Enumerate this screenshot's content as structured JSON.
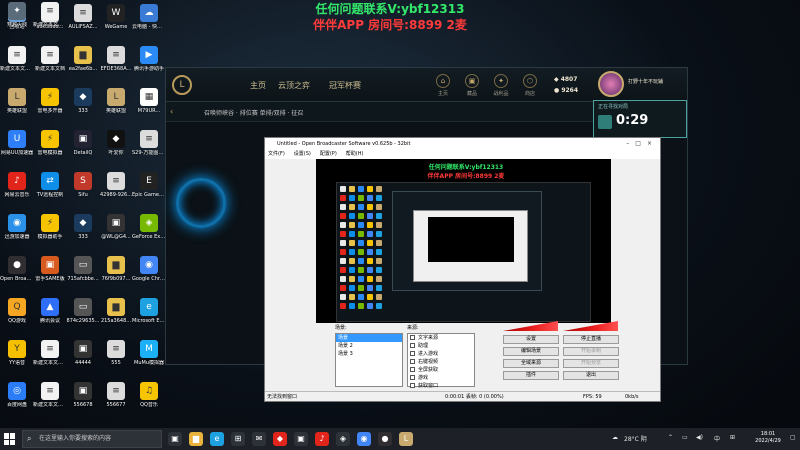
{
  "overlay": {
    "line1": "任何问题联系V:ybf12313",
    "line2": "伴伴APP 房间号:8899 2麦"
  },
  "desktop_icons": [
    {
      "label": "回收站",
      "icon": "recycle-bin-icon",
      "color": "#6aa0d8",
      "glyph": "♻"
    },
    {
      "label": "a363ddd...",
      "icon": "file-icon",
      "color": "#e9e9e9",
      "glyph": "▤"
    },
    {
      "label": "AULIFSAZ...",
      "icon": "document-icon",
      "color": "#dcdcdc",
      "glyph": "≡"
    },
    {
      "label": "WeGame",
      "icon": "wegame-icon",
      "color": "#222",
      "glyph": "W"
    },
    {
      "label": "云电脑 - 快捷方式",
      "icon": "cloud-pc-icon",
      "color": "#3a7bd5",
      "glyph": "☁"
    },
    {
      "label": "新建文本文档(5)",
      "icon": "text-file-icon",
      "color": "#f2f2f2",
      "glyph": "≡"
    },
    {
      "label": "新建文本文档",
      "icon": "text-file-icon",
      "color": "#f2f2f2",
      "glyph": "≡"
    },
    {
      "label": "ea2fae6b...",
      "icon": "folder-icon",
      "color": "#e8c04c",
      "glyph": "▆"
    },
    {
      "label": "EFDE368A...",
      "icon": "document-icon",
      "color": "#dcdcdc",
      "glyph": "≡"
    },
    {
      "label": "腾讯手游助手",
      "icon": "game-assistant-icon",
      "color": "#2a8af6",
      "glyph": "▶"
    },
    {
      "label": "英雄联盟",
      "icon": "lol-icon",
      "color": "#c8aa6e",
      "glyph": "L"
    },
    {
      "label": "雷电多开器",
      "icon": "emulator-icon",
      "color": "#f6c400",
      "glyph": "⚡"
    },
    {
      "label": "333",
      "icon": "app-icon",
      "color": "#1a3a5e",
      "glyph": "◆"
    },
    {
      "label": "英雄联盟",
      "icon": "lol-icon",
      "color": "#c8aa6e",
      "glyph": "L"
    },
    {
      "label": "M79UR...",
      "icon": "qr-icon",
      "color": "#fff",
      "glyph": "▦"
    },
    {
      "label": "网易UU加速器",
      "icon": "uu-accelerator-icon",
      "color": "#2d7ef7",
      "glyph": "U"
    },
    {
      "label": "雷电模拟器",
      "icon": "emulator-icon",
      "color": "#f6c400",
      "glyph": "⚡"
    },
    {
      "label": "DetailQ",
      "icon": "app-icon",
      "color": "#223",
      "glyph": "▣"
    },
    {
      "label": "叶爱你",
      "icon": "app-icon",
      "color": "#111",
      "glyph": "◆"
    },
    {
      "label": "S29-万能图计算器",
      "icon": "document-icon",
      "color": "#dcdcdc",
      "glyph": "≡"
    },
    {
      "label": "网易云音乐",
      "icon": "netease-music-icon",
      "color": "#e1251b",
      "glyph": "♪"
    },
    {
      "label": "TV远程控制",
      "icon": "teamviewer-icon",
      "color": "#0e8ee9",
      "glyph": "⇄"
    },
    {
      "label": "Sifu",
      "icon": "sifu-icon",
      "color": "#c0392b",
      "glyph": "S"
    },
    {
      "label": "42989-926...",
      "icon": "document-icon",
      "color": "#dcdcdc",
      "glyph": "≡"
    },
    {
      "label": "Epic Games Launcher",
      "icon": "epic-icon",
      "color": "#222",
      "glyph": "E"
    },
    {
      "label": "迅游加速器",
      "icon": "accelerator-icon",
      "color": "#2b90e8",
      "glyph": "◉"
    },
    {
      "label": "模拟器助手",
      "icon": "emulator-icon",
      "color": "#f6c400",
      "glyph": "⚡"
    },
    {
      "label": "333",
      "icon": "app-icon",
      "color": "#1a3a5e",
      "glyph": "◆"
    },
    {
      "label": "@WL@G4...",
      "icon": "app-icon",
      "color": "#333",
      "glyph": "▣"
    },
    {
      "label": "GeForce Experience",
      "icon": "nvidia-icon",
      "color": "#76b900",
      "glyph": "◈"
    },
    {
      "label": "Open Broadcast...",
      "icon": "obs-icon",
      "color": "#302e31",
      "glyph": "●"
    },
    {
      "label": "雷手SAME版",
      "icon": "app-icon",
      "color": "#d85a1f",
      "glyph": "▣"
    },
    {
      "label": "715afcbbe...",
      "icon": "image-icon",
      "color": "#555",
      "glyph": "▭"
    },
    {
      "label": "76f9b097...",
      "icon": "folder-icon",
      "color": "#e8c04c",
      "glyph": "▆"
    },
    {
      "label": "Google Chrome",
      "icon": "chrome-icon",
      "color": "#4285f4",
      "glyph": "◉"
    },
    {
      "label": "QQ游戏",
      "icon": "qq-game-icon",
      "color": "#f5a623",
      "glyph": "Q"
    },
    {
      "label": "腾讯会议",
      "icon": "tencent-meeting-icon",
      "color": "#2f6ef6",
      "glyph": "▲"
    },
    {
      "label": "874c29635...",
      "icon": "image-icon",
      "color": "#555",
      "glyph": "▭"
    },
    {
      "label": "215a3648...",
      "icon": "folder-icon",
      "color": "#e8c04c",
      "glyph": "▆"
    },
    {
      "label": "Microsoft Edge",
      "icon": "edge-icon",
      "color": "#1da1e0",
      "glyph": "e"
    },
    {
      "label": "YY语音",
      "icon": "yy-icon",
      "color": "#f5c000",
      "glyph": "Y"
    },
    {
      "label": "新建文本文档(2)",
      "icon": "text-file-icon",
      "color": "#f2f2f2",
      "glyph": "≡"
    },
    {
      "label": "44444",
      "icon": "app-icon",
      "color": "#333",
      "glyph": "▣"
    },
    {
      "label": "555",
      "icon": "document-icon",
      "color": "#dcdcdc",
      "glyph": "≡"
    },
    {
      "label": "MuMu模拟器",
      "icon": "mumu-icon",
      "color": "#1cb0f6",
      "glyph": "M"
    },
    {
      "label": "百度网盘",
      "icon": "baidu-netdisk-icon",
      "color": "#2a7cf7",
      "glyph": "◎"
    },
    {
      "label": "新建文本文档(3)",
      "icon": "text-file-icon",
      "color": "#f2f2f2",
      "glyph": "≡"
    },
    {
      "label": "556678",
      "icon": "app-icon",
      "color": "#333",
      "glyph": "▣"
    },
    {
      "label": "556677",
      "icon": "document-icon",
      "color": "#dcdcdc",
      "glyph": "≡"
    },
    {
      "label": "QQ音乐",
      "icon": "qq-music-icon",
      "color": "#f6c400",
      "glyph": "♫"
    },
    {
      "label": "穿越火线",
      "icon": "crossfire-icon",
      "color": "#5a6b7a",
      "glyph": "✦"
    },
    {
      "label": "新建文本文档(4)",
      "icon": "text-file-icon",
      "color": "#f2f2f2",
      "glyph": "≡"
    }
  ],
  "client": {
    "nav": [
      "主页",
      "云顶之弈",
      "冠军杯赛"
    ],
    "quick": [
      {
        "label": "主页",
        "glyph": "⌂"
      },
      {
        "label": "藏品",
        "glyph": "▣"
      },
      {
        "label": "战利品",
        "glyph": "✦"
      },
      {
        "label": "商店",
        "glyph": "⬡"
      }
    ],
    "currency_be": "4807",
    "currency_rp": "9264",
    "profile_name": "打野十年不玩辅",
    "breadcrumb": "召唤师峡谷 · 排位赛 单排/双排 · 征召"
  },
  "timer": {
    "label": "正在寻找对局",
    "value": "0:29"
  },
  "obs": {
    "title": "Untitled - Open Broadcaster Software v0.625b - 32bit",
    "menu": [
      "文件(F)",
      "设置(S)",
      "配置(P)",
      "帮助(H)"
    ],
    "scenes_label": "场景:",
    "sources_label": "来源:",
    "scenes": [
      "场景",
      "场景 2",
      "场景 3"
    ],
    "sources": [
      "文字来源",
      "助理",
      "进入游戏",
      "右键视频",
      "全屏获取",
      "游戏",
      "获取窗口"
    ],
    "buttons": [
      {
        "label": "设置",
        "disabled": false
      },
      {
        "label": "停止直播",
        "disabled": false
      },
      {
        "label": "编辑场景",
        "disabled": false
      },
      {
        "label": "开始录制",
        "disabled": true
      },
      {
        "label": "全域来源",
        "disabled": false
      },
      {
        "label": "开始预览",
        "disabled": true
      },
      {
        "label": "插件",
        "disabled": false
      },
      {
        "label": "退出",
        "disabled": false
      }
    ],
    "status_left": "无法找到窗口",
    "status_mid": "0:00:01 丢帧: 0 (0.00%)",
    "status_fps": "FPS: 59",
    "status_rate": "0kb/s"
  },
  "taskbar": {
    "search_placeholder": "在这里输入你要搜索的内容",
    "weather": "28°C 阴",
    "ime": "中",
    "time": "18:01",
    "date": "2022/4/29"
  }
}
